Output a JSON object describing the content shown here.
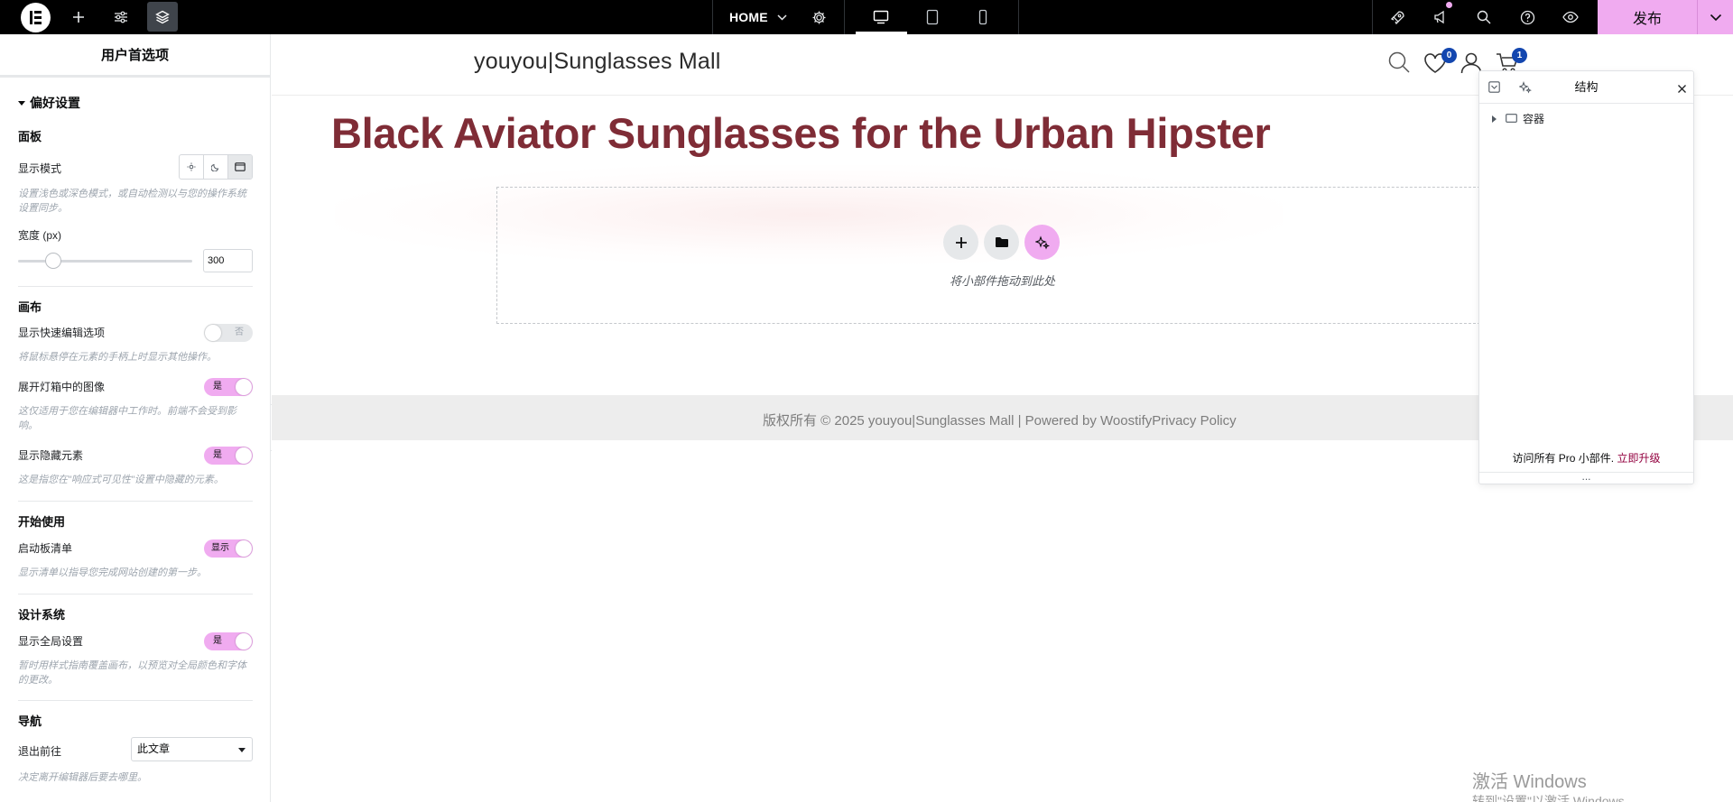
{
  "topbar": {
    "page_selector": "HOME",
    "publish_label": "发布"
  },
  "panel": {
    "title": "用户首选项",
    "section_title": "偏好设置",
    "groups": {
      "panel_group": "面板",
      "canvas_group": "画布",
      "start_group": "开始使用",
      "design_group": "设计系统",
      "nav_group": "导航"
    },
    "display_mode": {
      "label": "显示模式",
      "hint": "设置浅色或深色模式，或自动检测以与您的操作系统设置同步。"
    },
    "width": {
      "label": "宽度 (px)",
      "value": "300",
      "fraction": 0.18
    },
    "quick_edit": {
      "label": "显示快速编辑选项",
      "toggle": "否",
      "hint": "将鼠标悬停在元素的手柄上时显示其他操作。"
    },
    "lightbox": {
      "label": "展开灯箱中的图像",
      "toggle": "是",
      "hint": "这仅适用于您在编辑器中工作时。前端不会受到影响。"
    },
    "hidden_elements": {
      "label": "显示隐藏元素",
      "toggle": "是",
      "hint": "这是指您在\"响应式可见性\"设置中隐藏的元素。"
    },
    "checklist": {
      "label": "启动板清单",
      "toggle": "显示",
      "hint": "显示清单以指导您完成网站创建的第一步。"
    },
    "global_settings": {
      "label": "显示全局设置",
      "toggle": "是",
      "hint": "暂时用样式指南覆盖画布，以预览对全局颜色和字体的更改。"
    },
    "exit_to": {
      "label": "退出前往",
      "value": "此文章",
      "hint": "决定离开编辑器后要去哪里。"
    }
  },
  "canvas": {
    "site_title": "youyou|Sunglasses Mall",
    "wishlist_count": "0",
    "cart_count": "1",
    "headline": "Black Aviator Sunglasses for the Urban Hipster",
    "dropzone_text": "将小部件拖动到此处",
    "footer": "版权所有 © 2025 youyou|Sunglasses Mall | Powered by WoostifyPrivacy Policy"
  },
  "navigator": {
    "title": "结构",
    "item": "容器",
    "promo": "访问所有 Pro 小部件.",
    "promo_link": "立即升级",
    "footer": "..."
  },
  "watermark": {
    "line1": "激活 Windows",
    "line2": "转到\"设置\"以激活 Windows。"
  },
  "colors": {
    "accent_pink": "#f0abf0",
    "headline": "#7f2c36",
    "badge": "#1346af",
    "promo_link": "#93003f"
  }
}
